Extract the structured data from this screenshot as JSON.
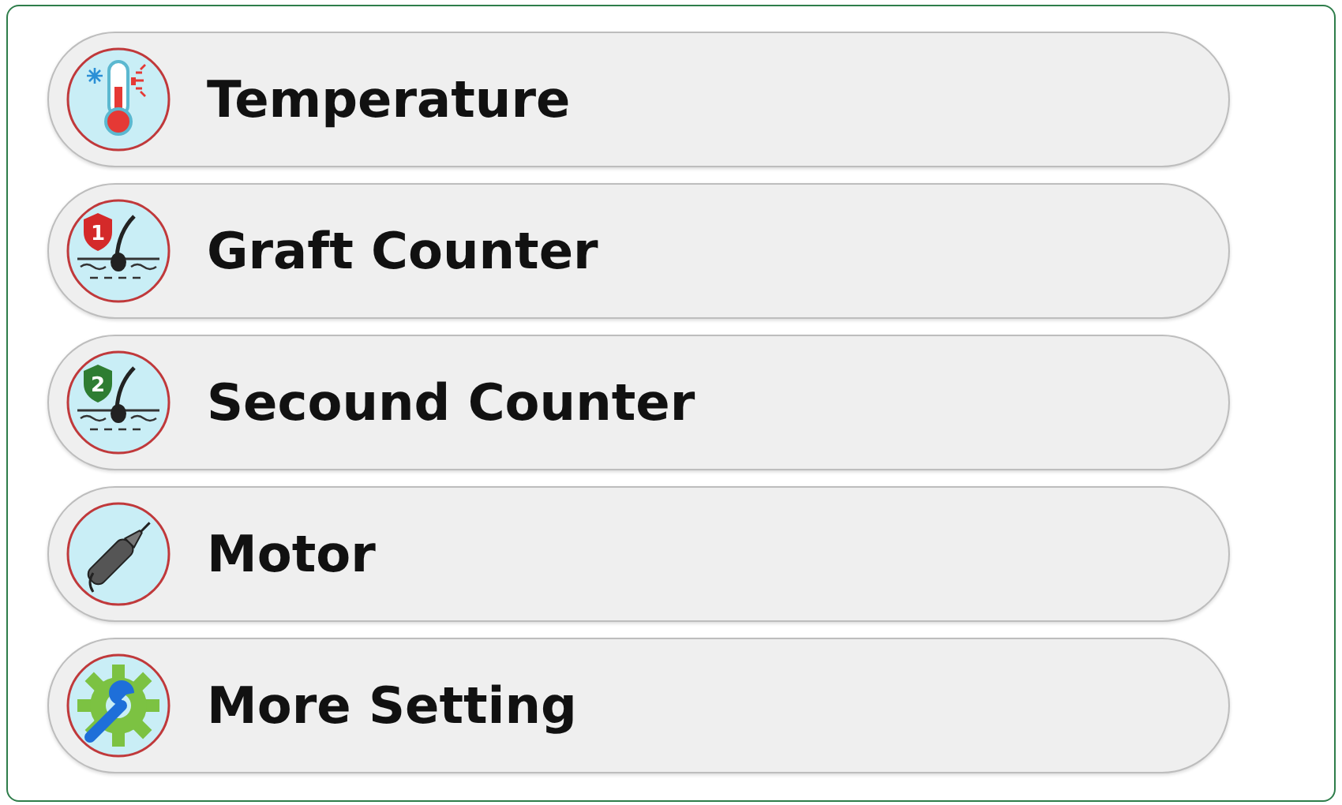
{
  "menu": [
    {
      "label": "Temperature",
      "kind": "temperature"
    },
    {
      "label": "Graft Counter",
      "kind": "counter",
      "badge": "1",
      "color": "#d42a2a"
    },
    {
      "label": "Secound Counter",
      "kind": "counter",
      "badge": "2",
      "color": "#2e7d32"
    },
    {
      "label": "Motor",
      "kind": "motor"
    },
    {
      "label": "More Setting",
      "kind": "settings"
    }
  ]
}
